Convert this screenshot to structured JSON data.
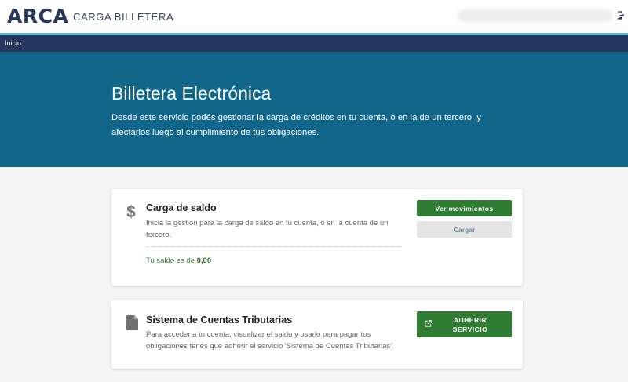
{
  "header": {
    "logo_text": "ARCA",
    "app_name": "CARGA BILLETERA",
    "user": "",
    "logout_icon": "logout-icon"
  },
  "colors": {
    "header_accent": "#5ab0d6",
    "navbar": "#27365f",
    "hero": "#12668a",
    "primary_button": "#2e7d32"
  },
  "nav": {
    "items": [
      {
        "label": "Inicio"
      }
    ]
  },
  "hero": {
    "title": "Billetera Electrónica",
    "description": "Desde este servicio podés gestionar la carga de créditos en tu cuenta, o en la de un tercero, y afectarlos luego al cumplimiento de tus obligaciones."
  },
  "cards": [
    {
      "icon": "dollar-icon",
      "title": "Carga de saldo",
      "description": "Iniciá la gestión para la carga de saldo en tu cuenta, o en la cuenta de un tercero.",
      "balance_label": "Tu saldo es de",
      "balance_value": "0,00",
      "buttons": [
        {
          "label": "Ver movimientos"
        },
        {
          "label": "Cargar"
        }
      ]
    },
    {
      "icon": "document-icon",
      "title": "Sistema de Cuentas Tributarias",
      "description": "Para acceder a tu cuenta, visualizar el saldo y usarlo para pagar tus obligaciones tenés que adherir el servicio 'Sistema de Cuentas Tributarias'.",
      "buttons": [
        {
          "label": "ADHERIR SERVICIO",
          "icon": "external-link-icon"
        }
      ]
    }
  ]
}
